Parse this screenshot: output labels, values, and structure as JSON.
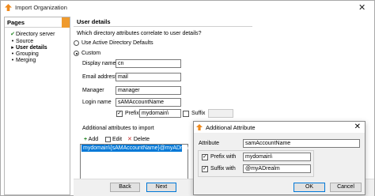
{
  "window": {
    "title": "Import Organization"
  },
  "left_panel": {
    "header": "Pages",
    "items": [
      {
        "marker": "✔",
        "label": "Directory server",
        "bold": false
      },
      {
        "marker": "•",
        "label": "Source",
        "bold": false
      },
      {
        "marker": "▸",
        "label": "User details",
        "bold": true
      },
      {
        "marker": "•",
        "label": "Grouping",
        "bold": false
      },
      {
        "marker": "•",
        "label": "Merging",
        "bold": false
      }
    ]
  },
  "user_details": {
    "header": "User details",
    "question": "Which directory attributes correlate to user details?",
    "option_default": "Use Active Directory Defaults",
    "option_custom": "Custom",
    "display_name_label": "Display name",
    "display_name_value": "cn",
    "email_label": "Email address",
    "email_value": "mail",
    "manager_label": "Manager",
    "manager_value": "manager",
    "login_label": "Login name",
    "login_value": "sAMAccountName",
    "prefix_label": "Prefix",
    "prefix_value": "mydomain\\",
    "suffix_label": "Suffix",
    "suffix_value": "",
    "additional_label": "Additional attributes to import",
    "add_label": "Add",
    "edit_label": "Edit",
    "delete_label": "Delete",
    "attributes": [
      "mydomain\\{sAMAccountName}@myADrealm"
    ]
  },
  "buttons": {
    "back": "Back",
    "next": "Next"
  },
  "dialog": {
    "title": "Additional Attribute",
    "attribute_label": "Attribute",
    "attribute_value": "samAccountName",
    "prefix_label": "Prefix with",
    "prefix_value": "mydomain\\",
    "suffix_label": "Suffix with",
    "suffix_value": "@myADrealm",
    "ok_label": "OK",
    "cancel_label": "Cancel"
  },
  "colors": {
    "accent": "#ef9a2d",
    "selection": "#0078d7"
  }
}
